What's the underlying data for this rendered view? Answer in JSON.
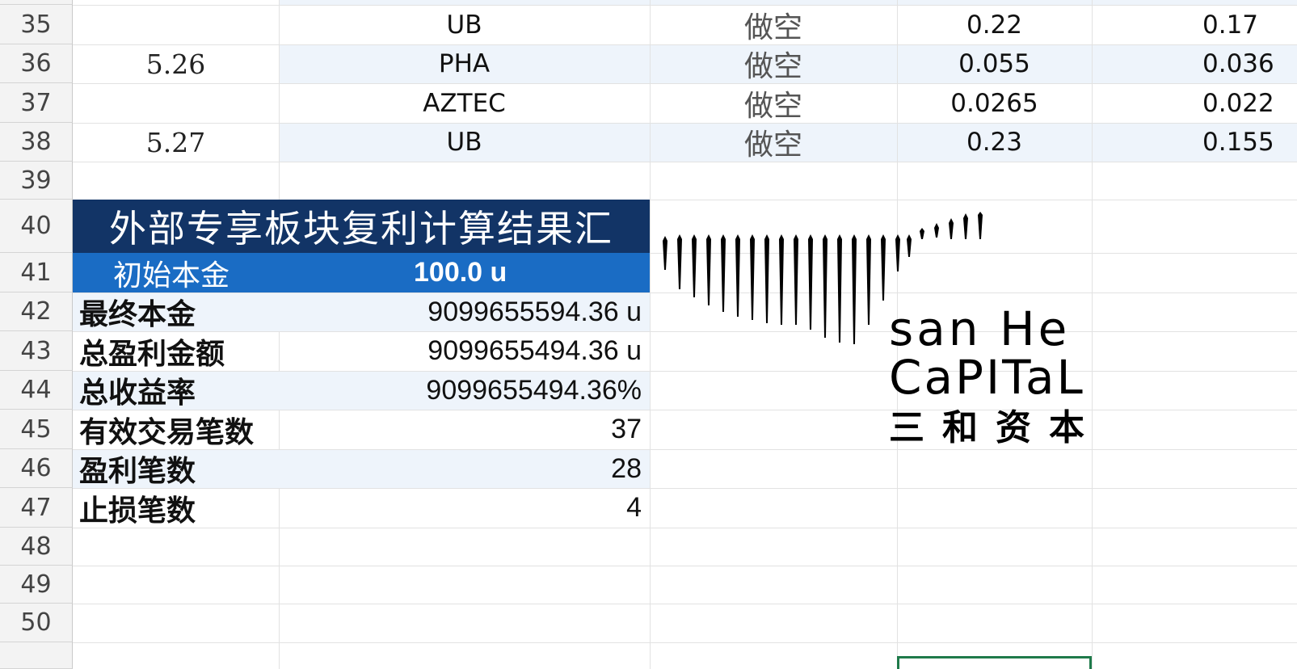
{
  "rows": [
    {
      "num": "35",
      "date": "",
      "symbol": "UB",
      "side": "做空",
      "entry": "0.22",
      "exit": "0.17"
    },
    {
      "num": "36",
      "date": "5.26",
      "symbol": "PHA",
      "side": "做空",
      "entry": "0.055",
      "exit": "0.036"
    },
    {
      "num": "37",
      "date": "",
      "symbol": "AZTEC",
      "side": "做空",
      "entry": "0.0265",
      "exit": "0.022"
    },
    {
      "num": "38",
      "date": "5.27",
      "symbol": "UB",
      "side": "做空",
      "entry": "0.23",
      "exit": "0.155"
    },
    {
      "num": "39"
    },
    {
      "num": "40"
    },
    {
      "num": "41"
    },
    {
      "num": "42"
    },
    {
      "num": "43"
    },
    {
      "num": "44"
    },
    {
      "num": "45"
    },
    {
      "num": "46"
    },
    {
      "num": "47"
    },
    {
      "num": "48"
    },
    {
      "num": "49"
    },
    {
      "num": "50"
    }
  ],
  "summary": {
    "title": "外部专享板块复利计算结果汇",
    "initial_label": "初始本金",
    "initial_value": "100.0 u",
    "items": [
      {
        "label": "最终本金",
        "value": "9099655594.36 u"
      },
      {
        "label": "总盈利金额",
        "value": "9099655494.36 u"
      },
      {
        "label": "总收益率",
        "value": "9099655494.36%"
      },
      {
        "label": "有效交易笔数",
        "value": "37"
      },
      {
        "label": "盈利笔数",
        "value": "28"
      },
      {
        "label": "止损笔数",
        "value": "4"
      }
    ]
  },
  "logo": {
    "line1": "san He",
    "line2": "CaPITaL",
    "line3": "三和资本"
  },
  "colors": {
    "title_bg": "#123466",
    "initial_bg": "#1a6cc4",
    "band": "#eef4fb",
    "selection": "#1f7a4a"
  }
}
